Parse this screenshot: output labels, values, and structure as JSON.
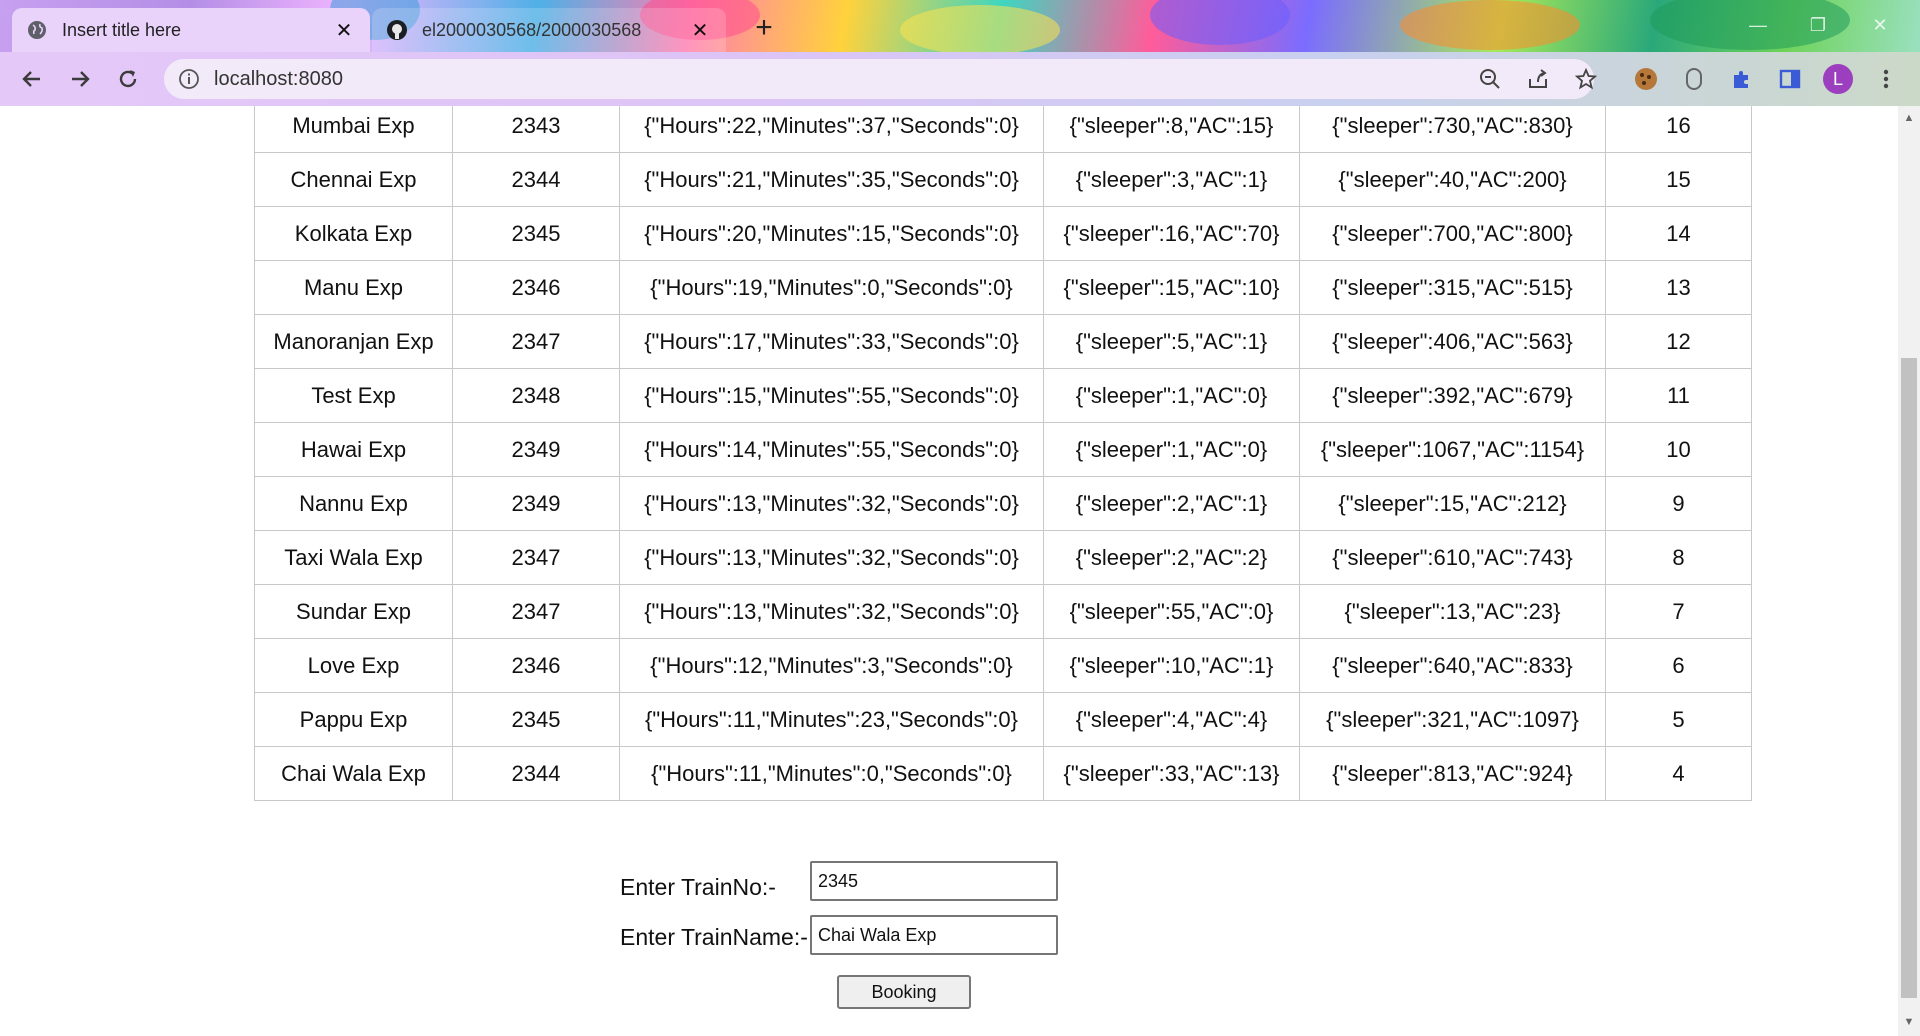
{
  "browser": {
    "tabs": [
      {
        "title": "Insert title here",
        "active": true,
        "icon": "globe-icon"
      },
      {
        "title": "el2000030568/2000030568",
        "active": false,
        "icon": "github-icon"
      }
    ],
    "url": "localhost:8080",
    "profile_initial": "L",
    "colors": {
      "accent": "#9c3fbf",
      "active_tab": "#e9d3fb"
    }
  },
  "table": {
    "rows": [
      {
        "name": "Mumbai Exp",
        "no": "2343",
        "time": "{\"Hours\":22,\"Minutes\":37,\"Seconds\":0}",
        "seats": "{\"sleeper\":8,\"AC\":15}",
        "fare": "{\"sleeper\":730,\"AC\":830}",
        "id": "16"
      },
      {
        "name": "Chennai Exp",
        "no": "2344",
        "time": "{\"Hours\":21,\"Minutes\":35,\"Seconds\":0}",
        "seats": "{\"sleeper\":3,\"AC\":1}",
        "fare": "{\"sleeper\":40,\"AC\":200}",
        "id": "15"
      },
      {
        "name": "Kolkata Exp",
        "no": "2345",
        "time": "{\"Hours\":20,\"Minutes\":15,\"Seconds\":0}",
        "seats": "{\"sleeper\":16,\"AC\":70}",
        "fare": "{\"sleeper\":700,\"AC\":800}",
        "id": "14"
      },
      {
        "name": "Manu Exp",
        "no": "2346",
        "time": "{\"Hours\":19,\"Minutes\":0,\"Seconds\":0}",
        "seats": "{\"sleeper\":15,\"AC\":10}",
        "fare": "{\"sleeper\":315,\"AC\":515}",
        "id": "13"
      },
      {
        "name": "Manoranjan Exp",
        "no": "2347",
        "time": "{\"Hours\":17,\"Minutes\":33,\"Seconds\":0}",
        "seats": "{\"sleeper\":5,\"AC\":1}",
        "fare": "{\"sleeper\":406,\"AC\":563}",
        "id": "12"
      },
      {
        "name": "Test Exp",
        "no": "2348",
        "time": "{\"Hours\":15,\"Minutes\":55,\"Seconds\":0}",
        "seats": "{\"sleeper\":1,\"AC\":0}",
        "fare": "{\"sleeper\":392,\"AC\":679}",
        "id": "11"
      },
      {
        "name": "Hawai Exp",
        "no": "2349",
        "time": "{\"Hours\":14,\"Minutes\":55,\"Seconds\":0}",
        "seats": "{\"sleeper\":1,\"AC\":0}",
        "fare": "{\"sleeper\":1067,\"AC\":1154}",
        "id": "10"
      },
      {
        "name": "Nannu Exp",
        "no": "2349",
        "time": "{\"Hours\":13,\"Minutes\":32,\"Seconds\":0}",
        "seats": "{\"sleeper\":2,\"AC\":1}",
        "fare": "{\"sleeper\":15,\"AC\":212}",
        "id": "9"
      },
      {
        "name": "Taxi Wala Exp",
        "no": "2347",
        "time": "{\"Hours\":13,\"Minutes\":32,\"Seconds\":0}",
        "seats": "{\"sleeper\":2,\"AC\":2}",
        "fare": "{\"sleeper\":610,\"AC\":743}",
        "id": "8"
      },
      {
        "name": "Sundar Exp",
        "no": "2347",
        "time": "{\"Hours\":13,\"Minutes\":32,\"Seconds\":0}",
        "seats": "{\"sleeper\":55,\"AC\":0}",
        "fare": "{\"sleeper\":13,\"AC\":23}",
        "id": "7"
      },
      {
        "name": "Love Exp",
        "no": "2346",
        "time": "{\"Hours\":12,\"Minutes\":3,\"Seconds\":0}",
        "seats": "{\"sleeper\":10,\"AC\":1}",
        "fare": "{\"sleeper\":640,\"AC\":833}",
        "id": "6"
      },
      {
        "name": "Pappu Exp",
        "no": "2345",
        "time": "{\"Hours\":11,\"Minutes\":23,\"Seconds\":0}",
        "seats": "{\"sleeper\":4,\"AC\":4}",
        "fare": "{\"sleeper\":321,\"AC\":1097}",
        "id": "5"
      },
      {
        "name": "Chai Wala Exp",
        "no": "2344",
        "time": "{\"Hours\":11,\"Minutes\":0,\"Seconds\":0}",
        "seats": "{\"sleeper\":33,\"AC\":13}",
        "fare": "{\"sleeper\":813,\"AC\":924}",
        "id": "4"
      }
    ]
  },
  "form": {
    "train_no_label": "Enter TrainNo:-",
    "train_no_value": "2345",
    "train_name_label": "Enter TrainName:-",
    "train_name_value": "Chai Wala Exp",
    "submit_label": "Booking"
  }
}
